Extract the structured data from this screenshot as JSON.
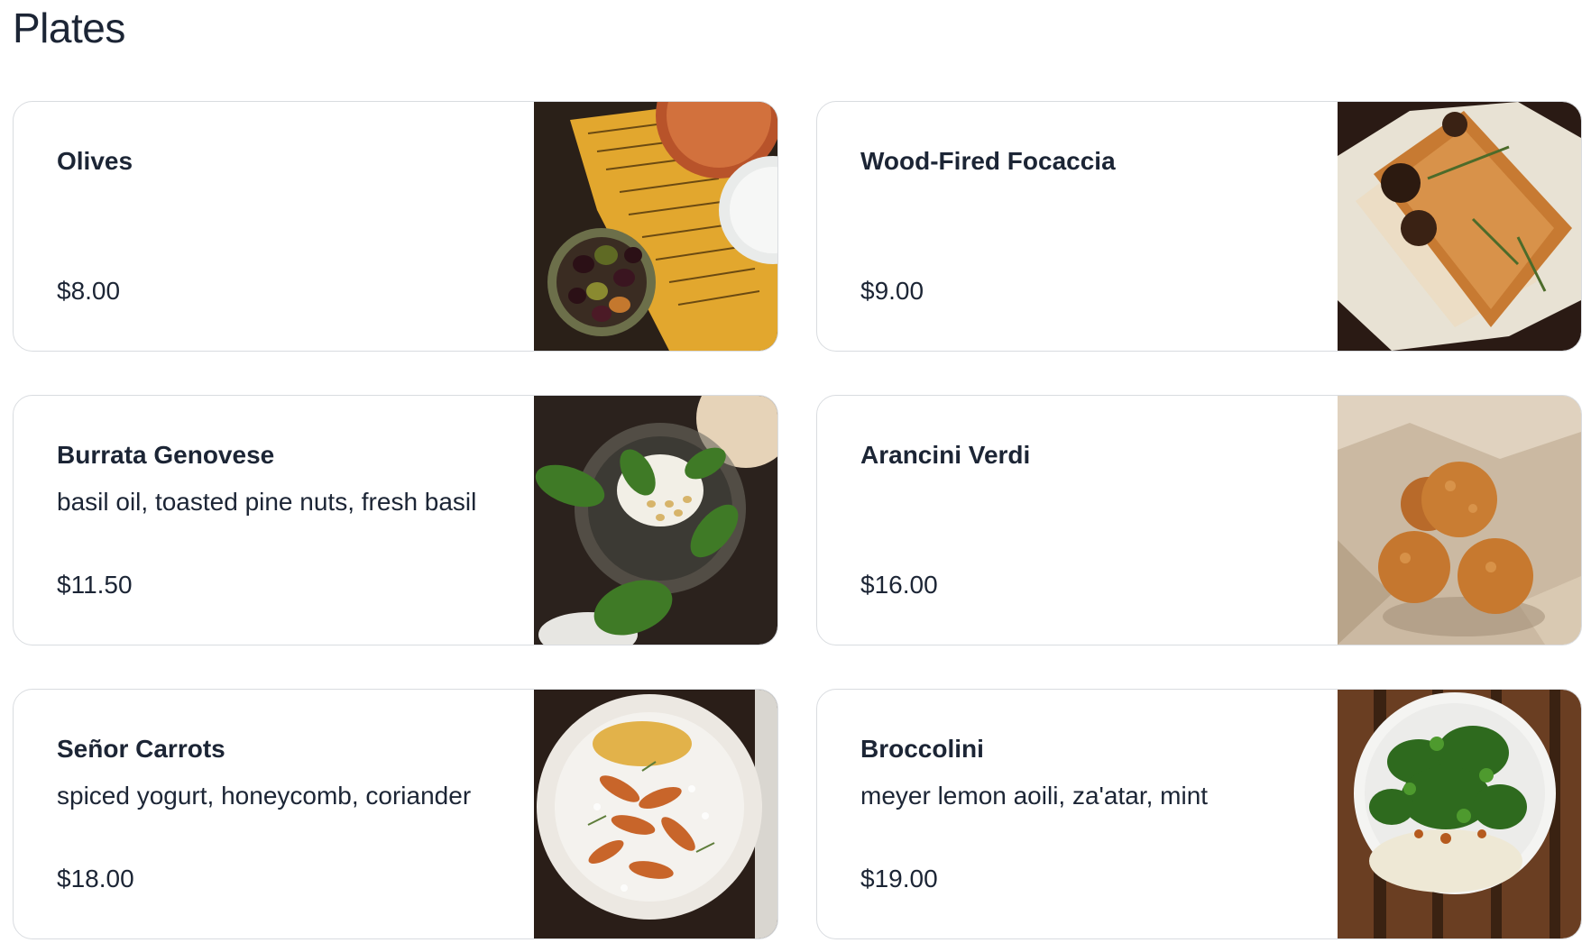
{
  "section": {
    "title": "Plates"
  },
  "items": [
    {
      "name": "Olives",
      "description": "",
      "price": "$8.00",
      "image_icon": "olives-photo"
    },
    {
      "name": "Wood-Fired Focaccia",
      "description": "",
      "price": "$9.00",
      "image_icon": "focaccia-photo"
    },
    {
      "name": "Burrata Genovese",
      "description": "basil oil, toasted pine nuts, fresh basil",
      "price": "$11.50",
      "image_icon": "burrata-photo"
    },
    {
      "name": "Arancini Verdi",
      "description": "",
      "price": "$16.00",
      "image_icon": "arancini-photo"
    },
    {
      "name": "Señor Carrots",
      "description": "spiced yogurt, honeycomb, coriander",
      "price": "$18.00",
      "image_icon": "carrots-photo"
    },
    {
      "name": "Broccolini",
      "description": "meyer lemon aoili, za'atar, mint",
      "price": "$19.00",
      "image_icon": "broccolini-photo"
    }
  ]
}
